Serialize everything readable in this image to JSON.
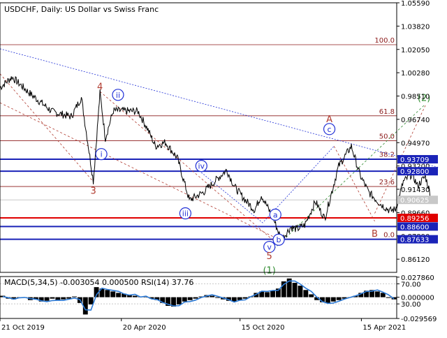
{
  "header": {
    "title": "USDCHF, Daily:  US Dollar vs Swiss Franc"
  },
  "colors": {
    "background": "#ffffff",
    "grid": "#c8c8c8",
    "price_line": "#000000",
    "fib_line": "#8b1a1a",
    "fib_text": "#8b1a1a",
    "blue_level": "#1a23b8",
    "red_level": "#e00000",
    "wave_blue": "#1f2fd6",
    "wave_red": "#b03a2e",
    "wave_green": "#2e8b2e",
    "macd_hist": "#000000",
    "macd_signal": "#2e7bd6",
    "badge_text": "#ffffff",
    "current_badge": "#c8c8c8"
  },
  "chart_data": [
    {
      "type": "line",
      "name": "main-price",
      "title": "USDCHF, Daily:  US Dollar vs Swiss Franc",
      "ylim": [
        0.8512,
        1.0559
      ],
      "y_ticks": [
        "1.05590",
        "1.03820",
        "1.02050",
        "1.00280",
        "0.98510",
        "0.96740",
        "0.94970",
        "0.93200",
        "0.91430",
        "0.89660",
        "0.87890",
        "0.86120"
      ],
      "x_ticks": [
        "21 Oct 2019",
        "20 Apr 2020",
        "15 Oct 2020",
        "15 Apr 2021"
      ],
      "x_range": [
        "2019-10-21",
        "2021-06-07"
      ],
      "anchors": [
        [
          "2019-10-21",
          0.9915
        ],
        [
          "2019-11-08",
          0.9995
        ],
        [
          "2019-12-05",
          0.987
        ],
        [
          "2020-01-08",
          0.973
        ],
        [
          "2020-02-05",
          0.9695
        ],
        [
          "2020-02-20",
          0.984
        ],
        [
          "2020-03-09",
          0.9205
        ],
        [
          "2020-03-19",
          0.9875
        ],
        [
          "2020-03-27",
          0.953
        ],
        [
          "2020-04-08",
          0.974
        ],
        [
          "2020-05-15",
          0.9735
        ],
        [
          "2020-05-29",
          0.9605
        ],
        [
          "2020-06-10",
          0.947
        ],
        [
          "2020-06-25",
          0.95
        ],
        [
          "2020-07-13",
          0.938
        ],
        [
          "2020-07-31",
          0.906
        ],
        [
          "2020-08-21",
          0.912
        ],
        [
          "2020-09-25",
          0.929
        ],
        [
          "2020-10-07",
          0.916
        ],
        [
          "2020-10-23",
          0.906
        ],
        [
          "2020-11-06",
          0.8985
        ],
        [
          "2020-11-16",
          0.91
        ],
        [
          "2020-12-04",
          0.892
        ],
        [
          "2020-12-16",
          0.876
        ],
        [
          "2020-12-30",
          0.8855
        ],
        [
          "2021-01-08",
          0.884
        ],
        [
          "2021-01-20",
          0.887
        ],
        [
          "2021-02-05",
          0.905
        ],
        [
          "2021-02-19",
          0.892
        ],
        [
          "2021-03-12",
          0.932
        ],
        [
          "2021-03-31",
          0.947
        ],
        [
          "2021-04-13",
          0.925
        ],
        [
          "2021-04-26",
          0.912
        ],
        [
          "2021-05-14",
          0.903
        ],
        [
          "2021-05-28",
          0.898
        ],
        [
          "2021-06-05",
          0.899
        ],
        [
          "2021-06-17",
          0.92
        ],
        [
          "2021-06-30",
          0.926
        ],
        [
          "2021-07-08",
          0.917
        ],
        [
          "2021-07-20",
          0.924
        ],
        [
          "2021-07-30",
          0.9062
        ]
      ],
      "fib_levels": [
        {
          "label": "100.0",
          "value": 1.0241
        },
        {
          "label": "61.8",
          "value": 0.9701
        },
        {
          "label": "50.0",
          "value": 0.9512
        },
        {
          "label": "38.2",
          "value": 0.9374
        },
        {
          "label": "23.6",
          "value": 0.9164
        },
        {
          "label": "0.0",
          "value": 0.8763
        }
      ],
      "price_levels": [
        {
          "label": "0.93709",
          "value": 0.93709,
          "kind": "blue"
        },
        {
          "label": "0.92800",
          "value": 0.928,
          "kind": "blue"
        },
        {
          "label": "0.89256",
          "value": 0.89256,
          "kind": "red"
        },
        {
          "label": "0.88600",
          "value": 0.886,
          "kind": "blue"
        },
        {
          "label": "0.87633",
          "value": 0.87633,
          "kind": "blue"
        }
      ],
      "current_price": {
        "label": "0.90625",
        "value": 0.90625
      },
      "wave_labels": [
        {
          "text": "4",
          "date": "2020-03-19",
          "value": 0.9925,
          "style": "red"
        },
        {
          "text": "3",
          "date": "2020-03-09",
          "value": 0.9135,
          "style": "red"
        },
        {
          "text": "ii",
          "date": "2020-04-15",
          "value": 0.986,
          "style": "blue-circle"
        },
        {
          "text": "i",
          "date": "2020-03-21",
          "value": 0.941,
          "style": "blue-circle"
        },
        {
          "text": "iv",
          "date": "2020-08-18",
          "value": 0.932,
          "style": "blue-circle"
        },
        {
          "text": "iii",
          "date": "2020-07-25",
          "value": 0.896,
          "style": "blue-circle"
        },
        {
          "text": "a",
          "date": "2020-12-07",
          "value": 0.895,
          "style": "blue-circle"
        },
        {
          "text": "b",
          "date": "2020-12-12",
          "value": 0.876,
          "style": "blue-circle"
        },
        {
          "text": "v",
          "date": "2020-11-28",
          "value": 0.8705,
          "style": "blue-circle"
        },
        {
          "text": "5",
          "date": "2020-11-28",
          "value": 0.864,
          "style": "red"
        },
        {
          "text": "(1)",
          "date": "2020-11-28",
          "value": 0.853,
          "style": "green"
        },
        {
          "text": "A",
          "date": "2021-02-26",
          "value": 0.968,
          "style": "red"
        },
        {
          "text": "c",
          "date": "2021-02-26",
          "value": 0.96,
          "style": "blue-circle"
        },
        {
          "text": "B",
          "date": "2021-05-05",
          "value": 0.881,
          "style": "red"
        },
        {
          "text": "(2)",
          "date": "2021-07-18",
          "value": 0.984,
          "style": "green"
        }
      ],
      "trendlines": [
        {
          "from": [
            "2019-10-21",
            1.021
          ],
          "to": [
            "2021-08-08",
            0.931
          ],
          "style": "blue-dotted"
        },
        {
          "from": [
            "2019-10-21",
            0.98
          ],
          "to": [
            "2020-12-05",
            0.878
          ],
          "style": "red-dashed"
        },
        {
          "from": [
            "2019-10-21",
            1.002
          ],
          "to": [
            "2020-03-09",
            0.92
          ],
          "style": "red-dashed"
        },
        {
          "from": [
            "2020-03-19",
            0.9885
          ],
          "to": [
            "2020-12-05",
            0.875
          ],
          "style": "red-dashed"
        },
        {
          "from": [
            "2020-12-05",
            0.869
          ],
          "to": [
            "2021-07-20",
            0.979
          ],
          "style": "green-dashed"
        },
        {
          "from": [
            "2021-05-05",
            0.896
          ],
          "to": [
            "2021-07-20",
            0.978
          ],
          "style": "red-dashed"
        },
        {
          "from": [
            "2020-08-18",
            0.927
          ],
          "to": [
            "2020-11-20",
            0.888
          ],
          "style": "blue-dotted"
        },
        {
          "from": [
            "2020-11-20",
            0.89
          ],
          "to": [
            "2021-03-05",
            0.947
          ],
          "style": "blue-dotted"
        },
        {
          "from": [
            "2021-03-05",
            0.947
          ],
          "to": [
            "2021-05-05",
            0.89
          ],
          "style": "red-dashed"
        }
      ]
    },
    {
      "type": "bar",
      "name": "macd-rsi",
      "title": "MACD(5,34,5) -0.003054 0.000500 RSI(14) 37.76",
      "ylim": [
        -0.0295,
        0.0287
      ],
      "y_ticks": [
        "0.027860",
        "70.00",
        "0.000000",
        "30.00",
        "-0.029569"
      ],
      "histogram": [
        0.002,
        -0.002,
        -0.003,
        -0.001,
        0.0,
        -0.004,
        -0.003,
        -0.006,
        -0.005,
        -0.002,
        -0.004,
        -0.003,
        -0.002,
        0.001,
        -0.008,
        -0.024,
        -0.01,
        0.014,
        0.012,
        0.01,
        0.008,
        0.006,
        0.005,
        0.003,
        0.002,
        0.001,
        0.0,
        -0.002,
        -0.004,
        -0.008,
        -0.012,
        -0.013,
        -0.01,
        -0.006,
        -0.004,
        -0.002,
        0.001,
        0.003,
        0.002,
        -0.001,
        -0.003,
        -0.005,
        -0.006,
        -0.004,
        -0.002,
        0.001,
        0.006,
        0.008,
        0.007,
        0.009,
        0.012,
        0.022,
        0.026,
        0.02,
        0.016,
        0.01,
        0.004,
        -0.004,
        -0.007,
        -0.008,
        -0.006,
        -0.004,
        -0.002,
        0.0,
        0.002,
        0.006,
        0.009,
        0.01,
        0.008,
        0.006,
        -0.001,
        -0.003
      ]
    }
  ]
}
